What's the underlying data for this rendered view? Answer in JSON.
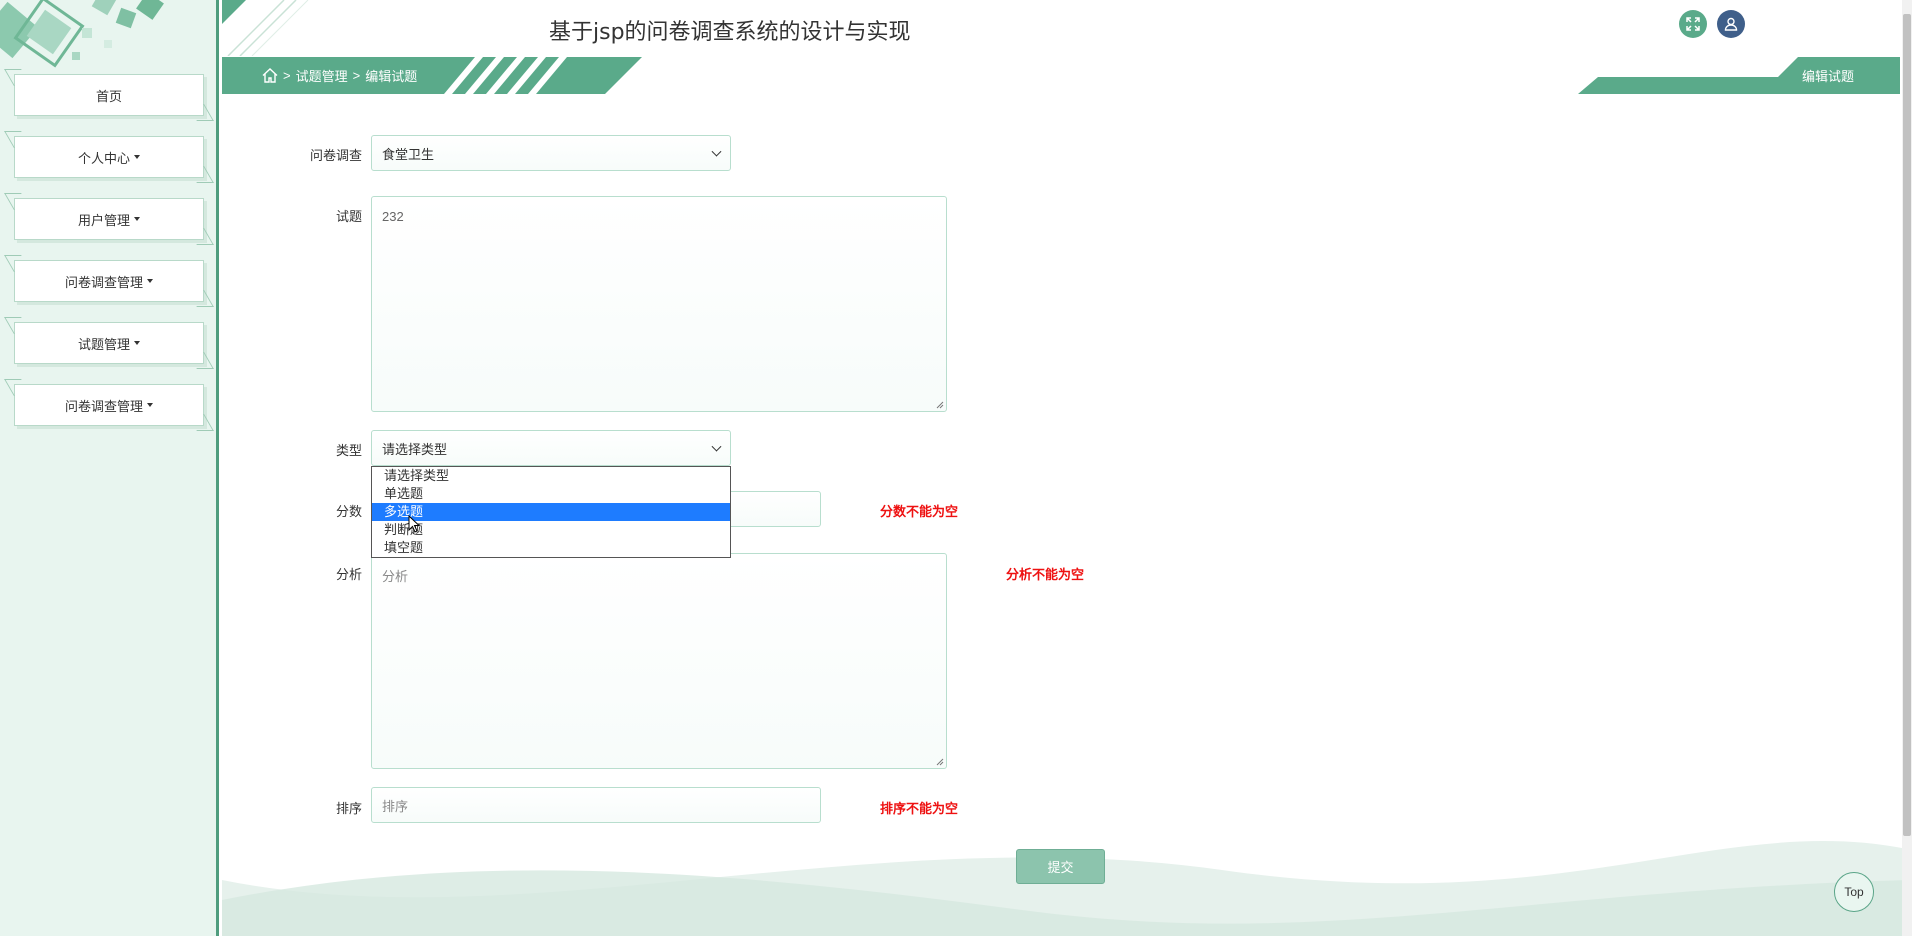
{
  "app": {
    "title": "基于jsp的问卷调查系统的设计与实现"
  },
  "sidebar": {
    "items": [
      {
        "label": "首页",
        "has_caret": false
      },
      {
        "label": "个人中心",
        "has_caret": true
      },
      {
        "label": "用户管理",
        "has_caret": true
      },
      {
        "label": "问卷调查管理",
        "has_caret": true
      },
      {
        "label": "试题管理",
        "has_caret": true
      },
      {
        "label": "问卷调查管理",
        "has_caret": true
      }
    ]
  },
  "header": {
    "fullscreen_icon": "expand-icon",
    "user_icon": "user-icon"
  },
  "breadcrumb": {
    "sep1": ">",
    "level1": "试题管理",
    "sep2": ">",
    "level2": "编辑试题"
  },
  "page_tab": {
    "label": "编辑试题"
  },
  "form": {
    "survey": {
      "label": "问卷调查",
      "value": "食堂卫生"
    },
    "question": {
      "label": "试题",
      "value": "232"
    },
    "type": {
      "label": "类型",
      "value": "请选择类型",
      "options": [
        "请选择类型",
        "单选题",
        "多选题",
        "判断题",
        "填空题"
      ],
      "highlighted": "多选题"
    },
    "score": {
      "label": "分数",
      "error": "分数不能为空"
    },
    "analysis": {
      "label": "分析",
      "placeholder": "分析",
      "error": "分析不能为空"
    },
    "order": {
      "label": "排序",
      "placeholder": "排序",
      "error": "排序不能为空"
    },
    "submit_label": "提交"
  },
  "top_button": {
    "label": "Top"
  },
  "colors": {
    "accent": "#5aaa8a",
    "sidebar_bg": "#e8f5ef",
    "error": "#ee1111",
    "highlight": "#1e7cff"
  }
}
